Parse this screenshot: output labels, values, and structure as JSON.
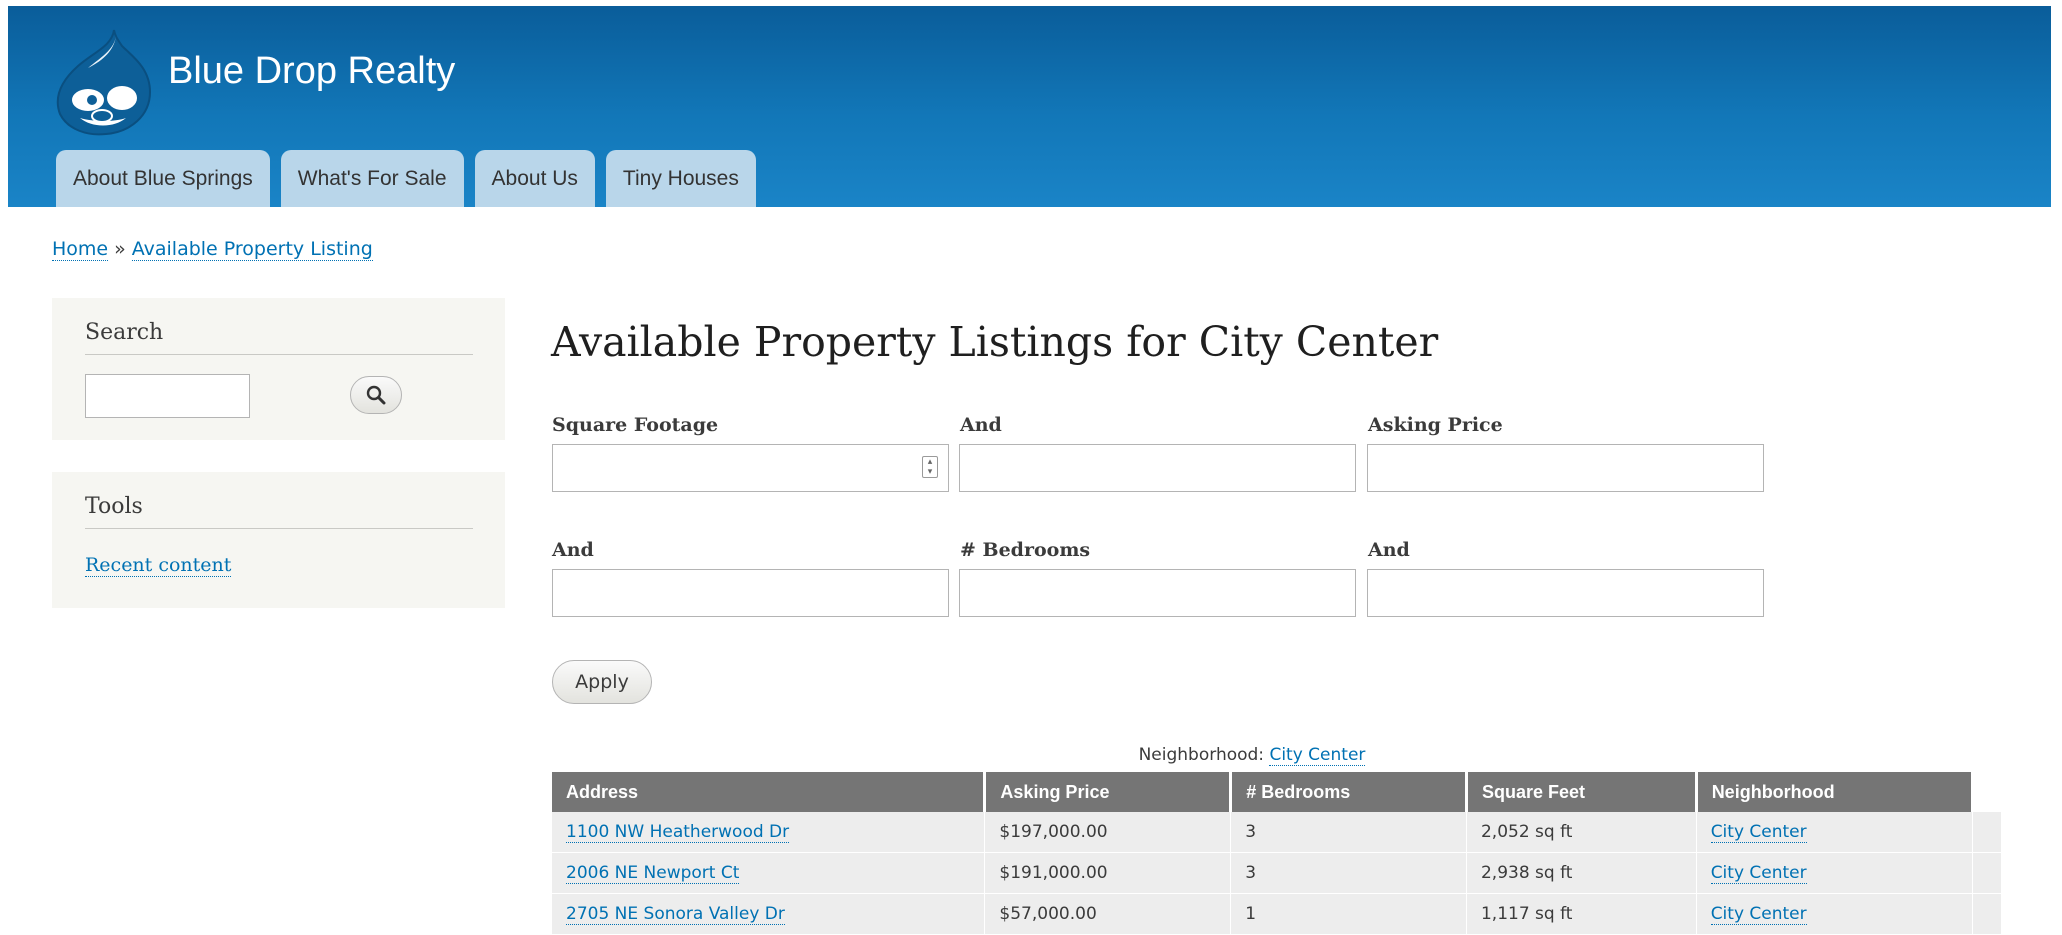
{
  "site": {
    "name": "Blue Drop Realty"
  },
  "menu": [
    "About Blue Springs",
    "What's For Sale",
    "About Us",
    "Tiny Houses"
  ],
  "breadcrumb": {
    "home": "Home",
    "separator": "»",
    "current": "Available Property Listing"
  },
  "sidebar": {
    "search": {
      "title": "Search",
      "value": ""
    },
    "tools": {
      "title": "Tools",
      "link": "Recent content"
    }
  },
  "main": {
    "title": "Available Property Listings for City Center",
    "filters": {
      "square_footage": "Square Footage",
      "and_1": "And",
      "asking_price": "Asking Price",
      "and_2": "And",
      "bedrooms": "# Bedrooms",
      "and_3": "And"
    },
    "apply_label": "Apply"
  },
  "table": {
    "caption_label": "Neighborhood:",
    "caption_link": "City Center",
    "headers": [
      "Address",
      "Asking Price",
      "# Bedrooms",
      "Square Feet",
      "Neighborhood"
    ],
    "rows": [
      [
        "1100 NW Heatherwood Dr",
        "$197,000.00",
        "3",
        "2,052 sq ft",
        "City Center"
      ],
      [
        "2006 NE Newport Ct",
        "$191,000.00",
        "3",
        "2,938 sq ft",
        "City Center"
      ],
      [
        "2705 NE Sonora Valley Dr",
        "$57,000.00",
        "1",
        "1,117 sq ft",
        "City Center"
      ]
    ]
  },
  "icons": {
    "logo": "drupal-drop-logo",
    "search": "magnifier-icon",
    "spinner": "number-spinner-icon"
  },
  "colors": {
    "header_top": "#0a5d9a",
    "header_bottom": "#1a84c7",
    "tab": "#b9d6ea",
    "link": "#0071b3",
    "table_header": "#757575",
    "row": "#ededed"
  }
}
